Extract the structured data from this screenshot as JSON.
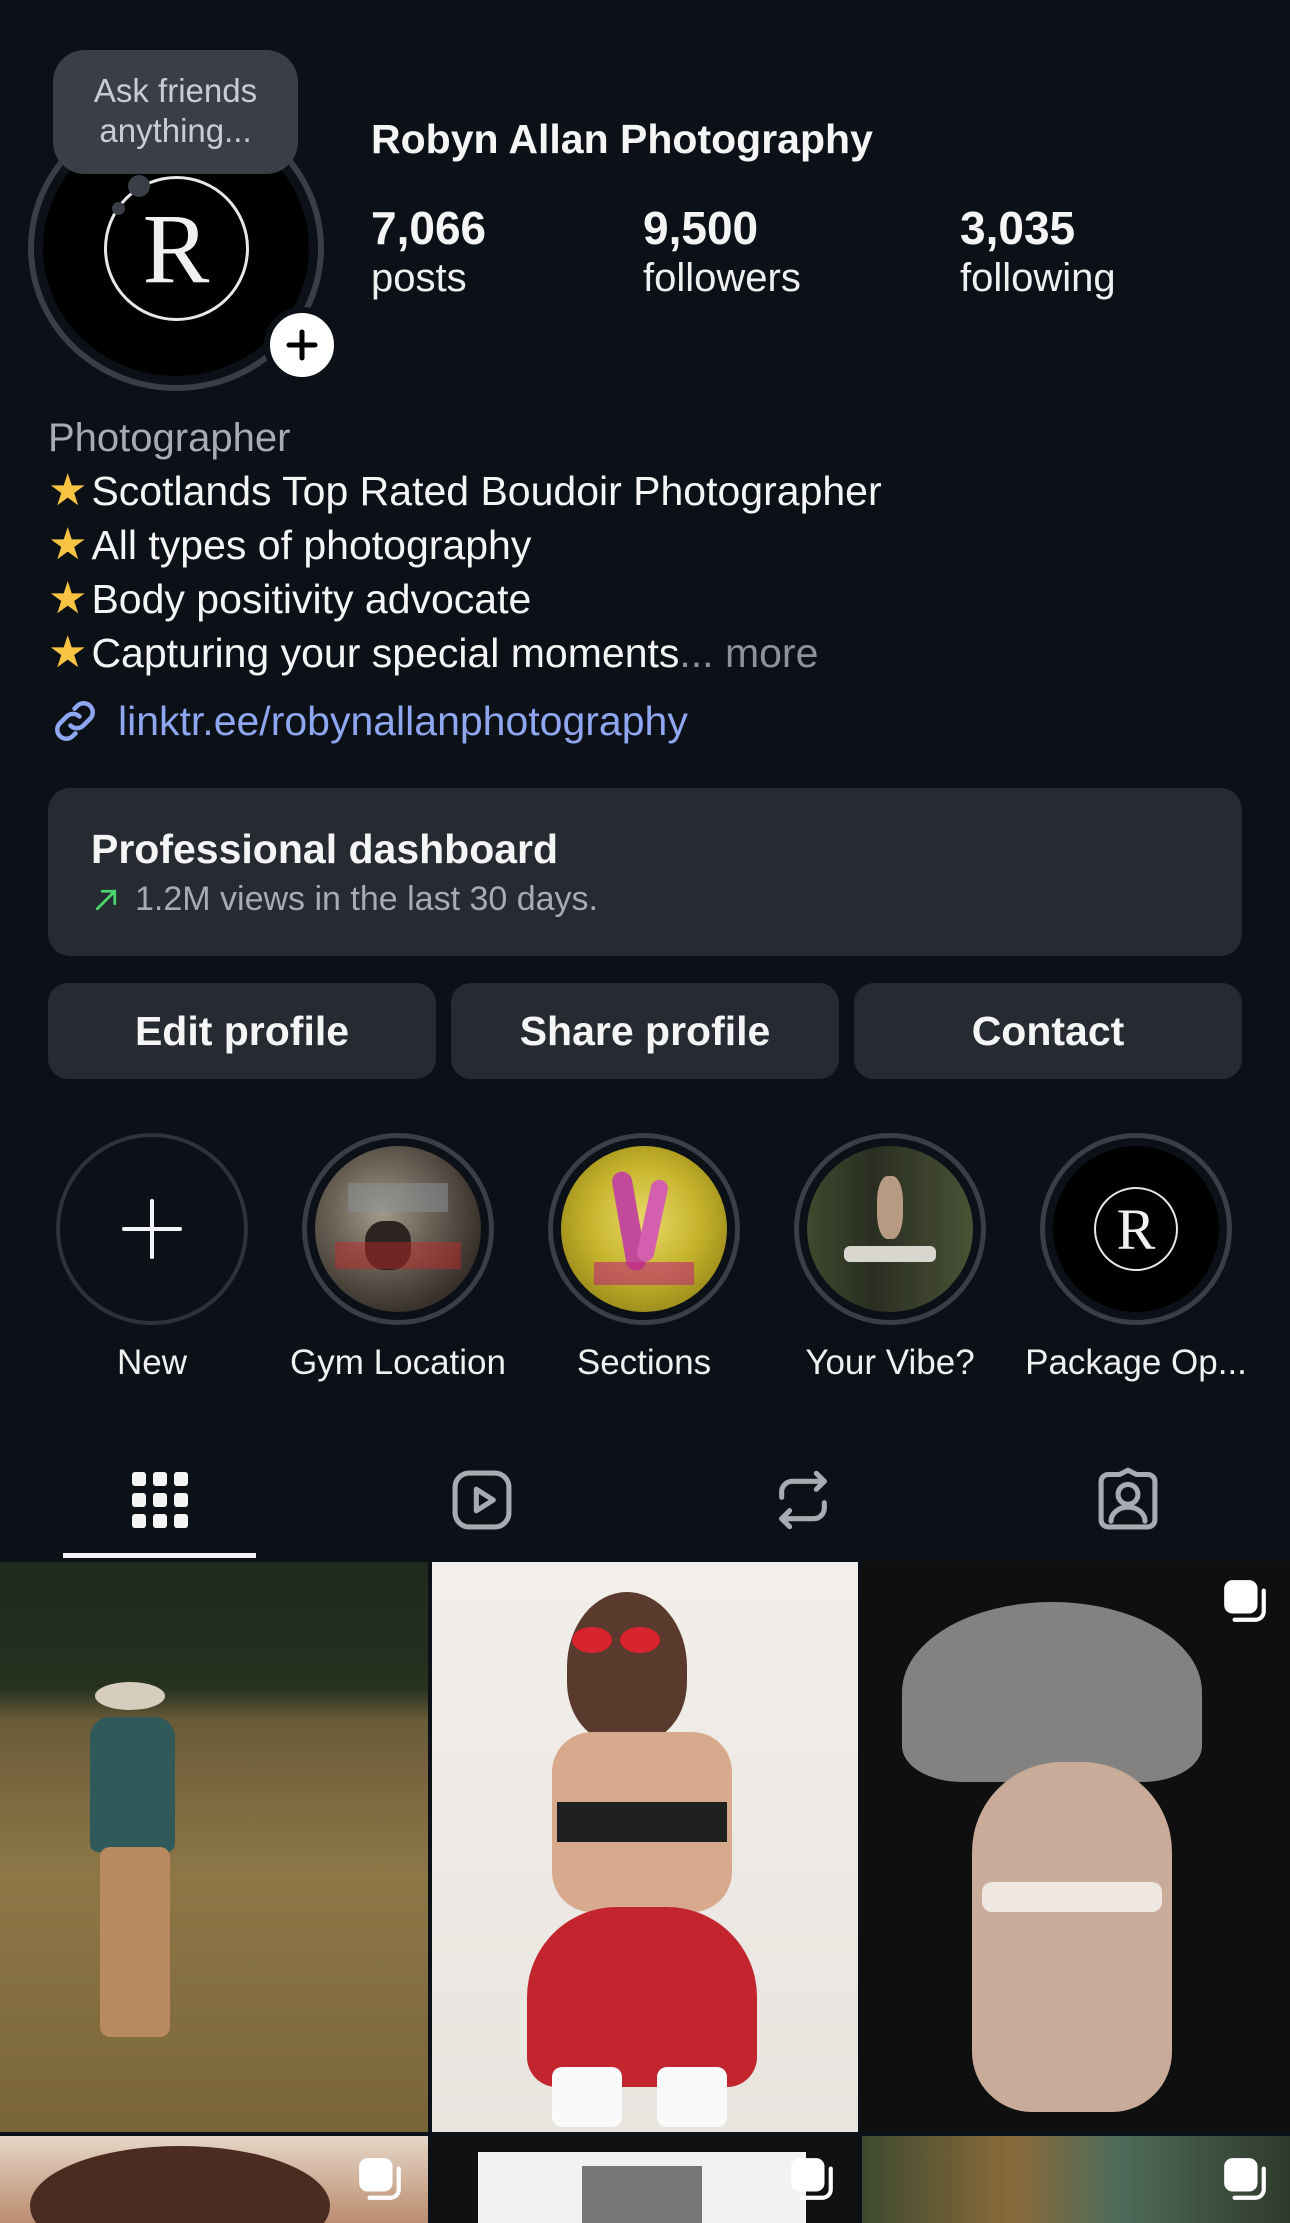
{
  "note": {
    "text": "Ask friends anything..."
  },
  "profile": {
    "name": "Robyn Allan Photography",
    "avatar_letter": "R",
    "stats": [
      {
        "value": "7,066",
        "label": "posts"
      },
      {
        "value": "9,500",
        "label": "followers"
      },
      {
        "value": "3,035",
        "label": "following"
      }
    ]
  },
  "bio": {
    "category": "Photographer",
    "lines": [
      "Scotlands Top Rated Boudoir Photographer",
      "All types of photography",
      "Body positivity advocate",
      "Capturing your special moments"
    ],
    "more_label": "... more",
    "link": "linktr.ee/robynallanphotography"
  },
  "dashboard": {
    "title": "Professional dashboard",
    "subtitle": "1.2M views in the last 30 days."
  },
  "actions": {
    "edit": "Edit profile",
    "share": "Share profile",
    "contact": "Contact"
  },
  "highlights": [
    {
      "label": "New"
    },
    {
      "label": "Gym Location"
    },
    {
      "label": "Sections"
    },
    {
      "label": "Your Vibe?"
    },
    {
      "label": "Package Op..."
    }
  ],
  "tabs": [
    "grid-icon",
    "reels-icon",
    "reposts-icon",
    "tagged-icon"
  ],
  "colors": {
    "background": "#0c1017",
    "card": "#262a31",
    "link": "#8fa6f0",
    "trend_up": "#4ad66d",
    "star": "#f6c343"
  }
}
